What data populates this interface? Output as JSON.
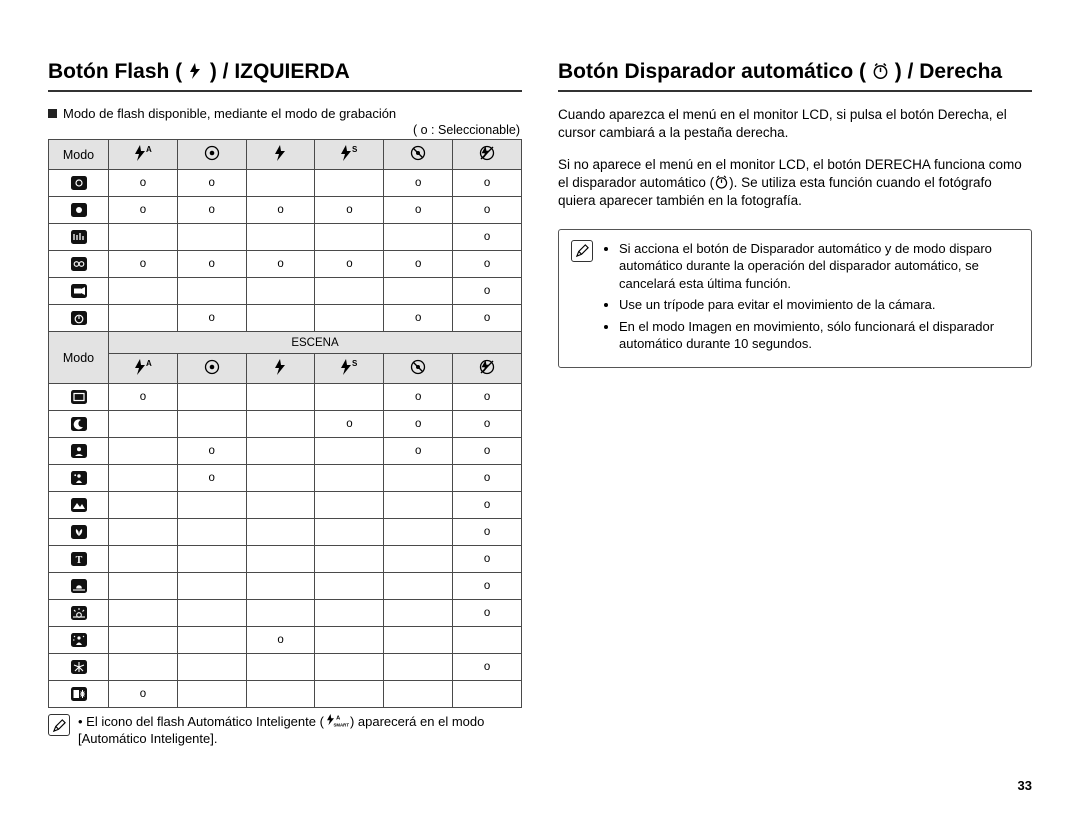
{
  "page_number": "33",
  "left": {
    "heading_pre": "Botón Flash (",
    "heading_post": ") / IZQUIERDA",
    "intro": "Modo de flash disponible, mediante el modo de grabación",
    "legend": "( o : Seleccionable)",
    "modo_label": "Modo",
    "escena_label": "ESCENA",
    "mark": "o",
    "col_icons": [
      "flash-auto",
      "redeye",
      "flash",
      "flash-slow",
      "redeye-fix",
      "no-flash"
    ],
    "rows1": [
      {
        "icon": "camera-a",
        "cells": [
          1,
          1,
          0,
          0,
          1,
          1
        ]
      },
      {
        "icon": "camera-p",
        "cells": [
          1,
          1,
          1,
          1,
          1,
          1
        ]
      },
      {
        "icon": "dual",
        "cells": [
          0,
          0,
          0,
          0,
          0,
          1
        ]
      },
      {
        "icon": "camera-g",
        "cells": [
          1,
          1,
          1,
          1,
          1,
          1
        ]
      },
      {
        "icon": "movie",
        "cells": [
          0,
          0,
          0,
          0,
          0,
          1
        ]
      },
      {
        "icon": "timer",
        "cells": [
          0,
          1,
          0,
          0,
          1,
          1
        ]
      }
    ],
    "rows2": [
      {
        "icon": "frame",
        "cells": [
          1,
          0,
          0,
          0,
          1,
          1
        ]
      },
      {
        "icon": "night",
        "cells": [
          0,
          0,
          0,
          1,
          1,
          1
        ]
      },
      {
        "icon": "portrait",
        "cells": [
          0,
          1,
          0,
          0,
          1,
          1
        ]
      },
      {
        "icon": "children",
        "cells": [
          0,
          1,
          0,
          0,
          0,
          1
        ]
      },
      {
        "icon": "landscape",
        "cells": [
          0,
          0,
          0,
          0,
          0,
          1
        ]
      },
      {
        "icon": "closeup",
        "cells": [
          0,
          0,
          0,
          0,
          0,
          1
        ]
      },
      {
        "icon": "text",
        "cells": [
          0,
          0,
          0,
          0,
          0,
          1
        ]
      },
      {
        "icon": "sunset",
        "cells": [
          0,
          0,
          0,
          0,
          0,
          1
        ]
      },
      {
        "icon": "dawn",
        "cells": [
          0,
          0,
          0,
          0,
          0,
          1
        ]
      },
      {
        "icon": "backlight",
        "cells": [
          0,
          0,
          1,
          0,
          0,
          0
        ]
      },
      {
        "icon": "firework",
        "cells": [
          0,
          0,
          0,
          0,
          0,
          1
        ]
      },
      {
        "icon": "beach-snow",
        "cells": [
          1,
          0,
          0,
          0,
          0,
          0
        ]
      }
    ],
    "footnote_pre": "El icono del flash Automático Inteligente (",
    "footnote_post": ") aparecerá en el modo [Automático Inteligente]."
  },
  "right": {
    "heading_pre": "Botón Disparador automático (",
    "heading_post": ") / Derecha",
    "para1": "Cuando aparezca el menú en el monitor LCD, si pulsa el botón Derecha, el cursor cambiará a la pestaña derecha.",
    "para2_pre": "Si no aparece el menú en el monitor LCD, el botón DERECHA funciona como el disparador automático (",
    "para2_post": "). Se utiliza esta función cuando el fotógrafo quiera aparecer también en la fotografía.",
    "notes": [
      "Si acciona el botón de Disparador automático y de modo disparo automático durante la operación del disparador automático, se cancelará esta última función.",
      "Use un trípode para evitar el movimiento de la cámara.",
      "En el modo Imagen en movimiento, sólo funcionará el disparador automático durante 10 segundos."
    ]
  }
}
